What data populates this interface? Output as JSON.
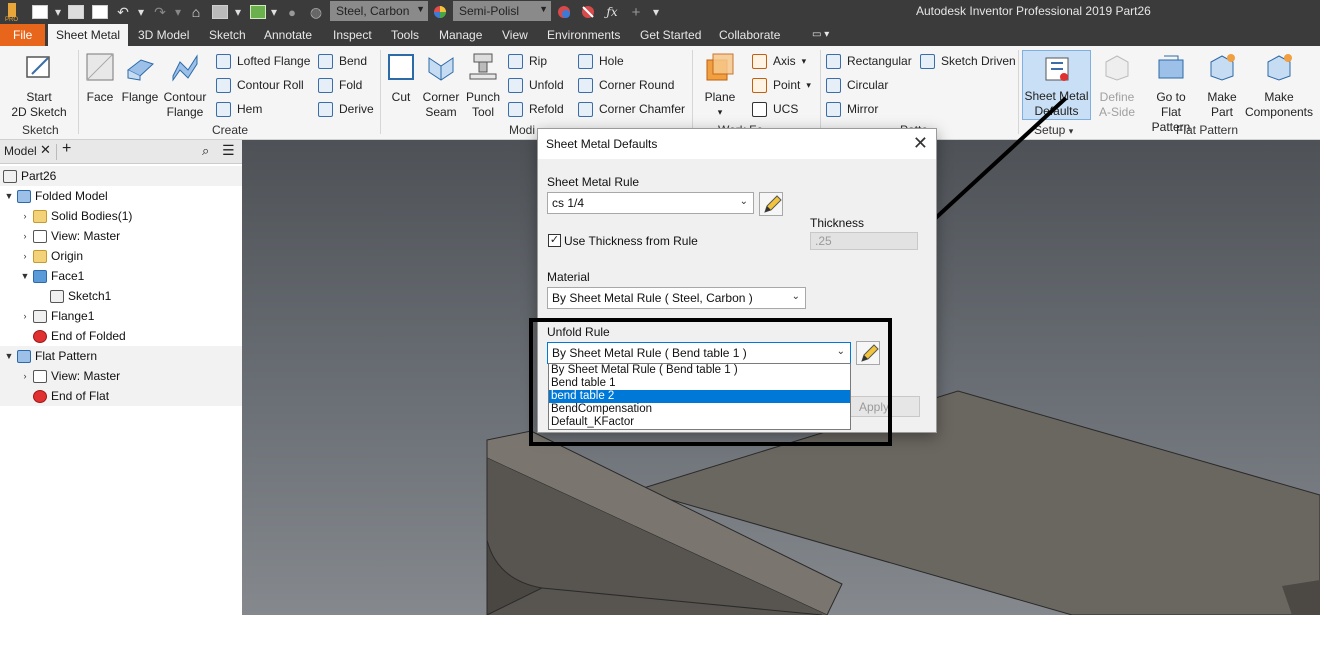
{
  "titlebar": {
    "app_title": "Autodesk Inventor Professional 2019   Part26",
    "material_combo": "Steel, Carbon",
    "appearance_combo": "Semi-Polisl"
  },
  "menu": {
    "file": "File",
    "tabs": [
      "Sheet Metal",
      "3D Model",
      "Sketch",
      "Annotate",
      "Inspect",
      "Tools",
      "Manage",
      "View",
      "Environments",
      "Get Started",
      "Collaborate"
    ]
  },
  "ribbon": {
    "sketch": {
      "start_line1": "Start",
      "start_line2": "2D Sketch",
      "panel": "Sketch"
    },
    "create": {
      "face": "Face",
      "flange": "Flange",
      "contour_flange_1": "Contour",
      "contour_flange_2": "Flange",
      "lofted_flange": "Lofted Flange",
      "contour_roll": "Contour Roll",
      "hem": "Hem",
      "bend": "Bend",
      "fold": "Fold",
      "derive": "Derive",
      "panel": "Create"
    },
    "modify": {
      "cut": "Cut",
      "corner_seam_1": "Corner",
      "corner_seam_2": "Seam",
      "punch_1": "Punch",
      "punch_2": "Tool",
      "rip": "Rip",
      "unfold": "Unfold",
      "refold": "Refold",
      "hole": "Hole",
      "corner_round": "Corner Round",
      "corner_chamfer": "Corner Chamfer",
      "panel": "Modi"
    },
    "work_features": {
      "plane": "Plane",
      "axis": "Axis",
      "point": "Point",
      "ucs": "UCS",
      "panel": "Work Fe"
    },
    "pattern": {
      "rectangular": "Rectangular",
      "circular": "Circular",
      "mirror": "Mirror",
      "sketch_driven": "Sketch Driven",
      "panel": "Patte"
    },
    "setup": {
      "defaults_1": "Sheet Metal",
      "defaults_2": "Defaults",
      "panel": "Setup"
    },
    "flat_pattern": {
      "define_1": "Define",
      "define_2": "A-Side",
      "goto_1": "Go to",
      "goto_2": "Flat Pattern",
      "make_part_1": "Make",
      "make_part_2": "Part",
      "make_comp_1": "Make",
      "make_comp_2": "Components",
      "panel": "Flat Pattern"
    }
  },
  "browser": {
    "tab": "Model",
    "tree": [
      {
        "label": "Part26",
        "icon": "part-icon"
      },
      {
        "label": "Folded Model",
        "icon": "folded-model-icon"
      },
      {
        "label": "Solid Bodies(1)",
        "icon": "folder-icon"
      },
      {
        "label": "View: Master",
        "icon": "view-icon"
      },
      {
        "label": "Origin",
        "icon": "folder-icon"
      },
      {
        "label": "Face1",
        "icon": "face-icon"
      },
      {
        "label": "Sketch1",
        "icon": "sketch-icon"
      },
      {
        "label": "Flange1",
        "icon": "flange-icon"
      },
      {
        "label": "End of Folded",
        "icon": "end-icon"
      },
      {
        "label": "Flat Pattern",
        "icon": "flat-pattern-icon"
      },
      {
        "label": "View: Master",
        "icon": "view-icon"
      },
      {
        "label": "End of Flat",
        "icon": "end-icon"
      }
    ]
  },
  "dialog": {
    "title": "Sheet Metal Defaults",
    "sheet_metal_rule_label": "Sheet Metal Rule",
    "sheet_metal_rule_value": "cs 1/4",
    "use_thickness_label": "Use Thickness from Rule",
    "use_thickness_checked": true,
    "thickness_label": "Thickness",
    "thickness_value": ".25",
    "material_label": "Material",
    "material_value": "By Sheet Metal Rule ( Steel, Carbon )",
    "unfold_rule_label": "Unfold Rule",
    "unfold_rule_value": "By Sheet Metal Rule ( Bend table 1 )",
    "unfold_options": [
      "By Sheet Metal Rule ( Bend table 1 )",
      "Bend table 1",
      "bend table 2",
      "BendCompensation",
      "Default_KFactor"
    ],
    "unfold_selected_index": 2,
    "apply": "Apply"
  },
  "colors": {
    "title_bar": "#3b3b3b",
    "file_tab": "#e8661b",
    "ribbon": "#f5f5f5",
    "selection": "#0078d7",
    "viewport_top": "#4e5257",
    "model_face": "#6a6660"
  }
}
